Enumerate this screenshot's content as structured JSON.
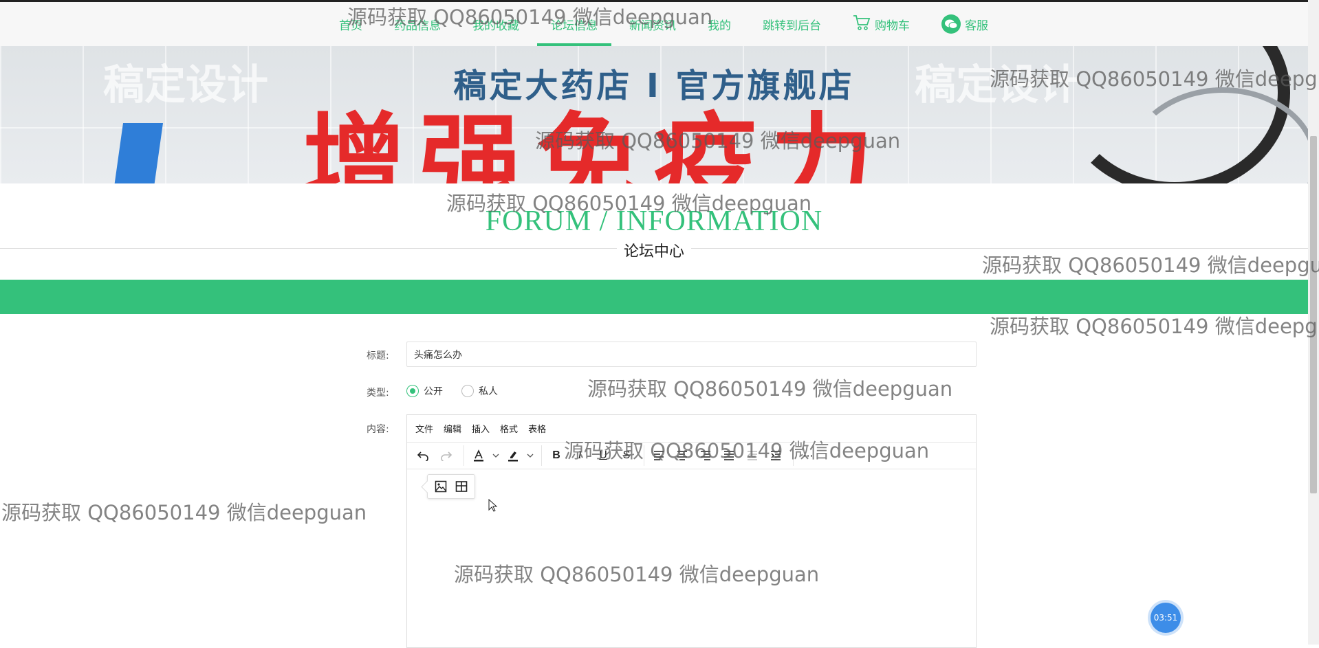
{
  "nav": {
    "items": [
      {
        "label": "首页"
      },
      {
        "label": "药品信息"
      },
      {
        "label": "我的收藏"
      },
      {
        "label": "论坛信息"
      },
      {
        "label": "新闻资讯"
      },
      {
        "label": "我的"
      },
      {
        "label": "跳转到后台"
      },
      {
        "label": "购物车"
      },
      {
        "label": "客服"
      }
    ],
    "active": "论坛信息"
  },
  "banner": {
    "title": "稿定大药店 I 官方旗舰店",
    "slogan": "增强免疫力",
    "decor_text": "稿定设计"
  },
  "section": {
    "title_en": "FORUM / INFORMATION",
    "title_cn": "论坛中心"
  },
  "form": {
    "title_label": "标题:",
    "title_value": "头痛怎么办",
    "type_label": "类型:",
    "type_options": [
      "公开",
      "私人"
    ],
    "type_selected": "公开",
    "content_label": "内容:"
  },
  "editor": {
    "menus": [
      "文件",
      "编辑",
      "插入",
      "格式",
      "表格"
    ],
    "toolbar": [
      "undo-icon",
      "redo-icon",
      "text-color-icon",
      "highlight-icon",
      "bold-icon",
      "italic-icon",
      "underline-icon",
      "strikethrough-icon",
      "align-left-icon",
      "align-center-icon",
      "align-right-icon",
      "align-justify-icon",
      "outdent-icon",
      "indent-icon",
      "more-icon"
    ],
    "quickbar": [
      "image-icon",
      "table-icon"
    ],
    "bold_glyph": "B",
    "italic_glyph": "I",
    "underline_glyph": "U",
    "strike_glyph": "S",
    "more_glyph": "···"
  },
  "timer": "03:51",
  "watermark": "源码获取 QQ86050149 微信deepguan",
  "colors": {
    "accent": "#34c17b",
    "banner_title": "#2f5f8a",
    "slogan": "#e52a2a"
  }
}
